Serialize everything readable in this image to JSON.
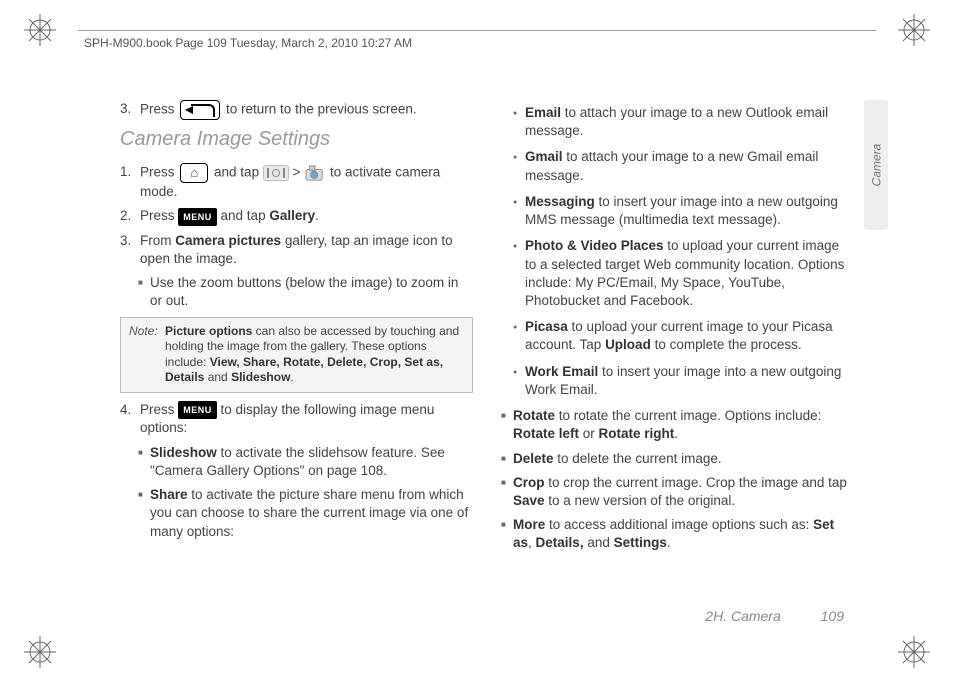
{
  "header": {
    "doc_info": "SPH-M900.book  Page 109  Tuesday, March 2, 2010  10:27 AM"
  },
  "left": {
    "step3_prefix": "3.",
    "step3_a": "Press ",
    "step3_b": " to return to the previous screen.",
    "heading": "Camera Image Settings",
    "s1_prefix": "1.",
    "s1_a": "Press ",
    "s1_b": " and tap ",
    "s1_c": " > ",
    "s1_d": " to activate camera mode.",
    "s2_prefix": "2.",
    "s2_a": "Press ",
    "menu_label": "MENU",
    "s2_b": " and tap ",
    "s2_gallery": "Gallery",
    "s2_c": ".",
    "s3_prefix": "3.",
    "s3_a": "From ",
    "s3_bold": "Camera pictures",
    "s3_b": " gallery, tap an image icon to open the image.",
    "s3_sub": "Use the zoom buttons (below the image) to zoom in or out.",
    "note_label": "Note:",
    "note_a": "Picture options",
    "note_b": " can also be accessed by touching and holding the image from the gallery. These options include: ",
    "note_opts": "View, Share, Rotate, Delete, Crop, Set as, Details",
    "note_c": " and ",
    "note_d": "Slideshow",
    "note_e": ".",
    "s4_prefix": "4.",
    "s4_a": "Press ",
    "s4_b": " to display the following image menu options:",
    "b1_bold": "Slideshow",
    "b1_txt": " to activate the slidehsow feature. See \"Camera Gallery Options\" on page 108.",
    "b2_bold": "Share",
    "b2_txt": " to activate the picture share menu from which you can choose to share the current image via one of many options:"
  },
  "right": {
    "r1_bold": "Email",
    "r1_txt": " to attach your image to a new Outlook email message.",
    "r2_bold": "Gmail",
    "r2_txt": " to attach your image to a new Gmail email message.",
    "r3_bold": "Messaging",
    "r3_txt": " to insert your image into a new outgoing MMS message (multimedia text message).",
    "r4_bold": "Photo & Video Places",
    "r4_txt": " to upload your current image to a selected target Web community location. Options include: My PC/Email, My Space, YouTube, Photobucket and Facebook.",
    "r5_bold": "Picasa",
    "r5_txt_a": " to upload your current image to your Picasa account. Tap ",
    "r5_upload": "Upload",
    "r5_txt_b": " to complete the process.",
    "r6_bold": "Work Email",
    "r6_txt": " to insert your image into a new outgoing Work Email.",
    "r7_bold": "Rotate",
    "r7_txt_a": " to rotate the current image. Options include: ",
    "r7_left": "Rotate left",
    "r7_or": " or ",
    "r7_right": "Rotate right",
    "r7_dot": ".",
    "r8_bold": "Delete",
    "r8_txt": " to delete the current image.",
    "r9_bold": "Crop",
    "r9_txt_a": " to crop the current image. Crop the image and tap ",
    "r9_save": "Save",
    "r9_txt_b": " to a new version of the original.",
    "r10_bold": "More",
    "r10_txt_a": " to access additional image options such as: ",
    "r10_setas": "Set as",
    "r10_c1": ", ",
    "r10_details": "Details,",
    "r10_and": " and ",
    "r10_settings": "Settings",
    "r10_dot": "."
  },
  "side_tab": "Camera",
  "footer": {
    "section": "2H. Camera",
    "page": "109"
  }
}
